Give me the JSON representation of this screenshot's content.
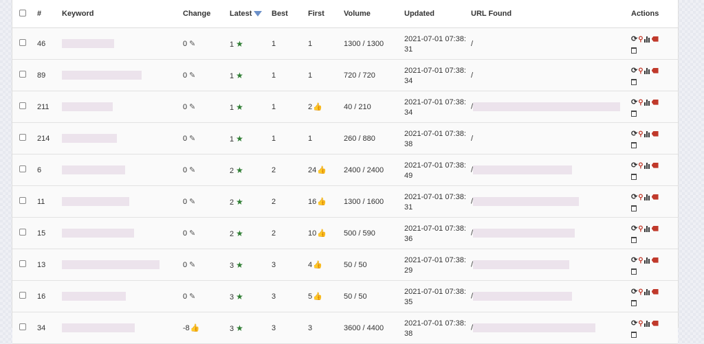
{
  "headers": {
    "num": "#",
    "keyword": "Keyword",
    "change": "Change",
    "latest": "Latest",
    "best": "Best",
    "first": "First",
    "volume": "Volume",
    "updated": "Updated",
    "url": "URL Found",
    "actions": "Actions"
  },
  "rows": [
    {
      "id": "46",
      "change": "0",
      "latest": "1",
      "best": "1",
      "first": "1",
      "first_up": false,
      "volume": "1300 / 1300",
      "updated_date": "2021-07-01 07:38:",
      "updated_sec": "31",
      "url": "/"
    },
    {
      "id": "89",
      "change": "0",
      "latest": "1",
      "best": "1",
      "first": "1",
      "first_up": false,
      "volume": "720 / 720",
      "updated_date": "2021-07-01 07:38:",
      "updated_sec": "34",
      "url": "/"
    },
    {
      "id": "211",
      "change": "0",
      "latest": "1",
      "best": "1",
      "first": "2",
      "first_up": true,
      "volume": "40 / 210",
      "updated_date": "2021-07-01 07:38:",
      "updated_sec": "34",
      "url": "/"
    },
    {
      "id": "214",
      "change": "0",
      "latest": "1",
      "best": "1",
      "first": "1",
      "first_up": false,
      "volume": "260 / 880",
      "updated_date": "2021-07-01 07:38:",
      "updated_sec": "38",
      "url": "/"
    },
    {
      "id": "6",
      "change": "0",
      "latest": "2",
      "best": "2",
      "first": "24",
      "first_up": true,
      "volume": "2400 / 2400",
      "updated_date": "2021-07-01 07:38:",
      "updated_sec": "49",
      "url": "/"
    },
    {
      "id": "11",
      "change": "0",
      "latest": "2",
      "best": "2",
      "first": "16",
      "first_up": true,
      "volume": "1300 / 1600",
      "updated_date": "2021-07-01 07:38:",
      "updated_sec": "31",
      "url": "/"
    },
    {
      "id": "15",
      "change": "0",
      "latest": "2",
      "best": "2",
      "first": "10",
      "first_up": true,
      "volume": "500 / 590",
      "updated_date": "2021-07-01 07:38:",
      "updated_sec": "36",
      "url": "/"
    },
    {
      "id": "13",
      "change": "0",
      "latest": "3",
      "best": "3",
      "first": "4",
      "first_up": true,
      "volume": "50 / 50",
      "updated_date": "2021-07-01 07:38:",
      "updated_sec": "29",
      "url": "/"
    },
    {
      "id": "16",
      "change": "0",
      "latest": "3",
      "best": "3",
      "first": "5",
      "first_up": true,
      "volume": "50 / 50",
      "updated_date": "2021-07-01 07:38:",
      "updated_sec": "35",
      "url": "/"
    },
    {
      "id": "34",
      "change": "-8",
      "latest": "3",
      "best": "3",
      "first": "3",
      "first_up": false,
      "volume": "3600 / 4400",
      "updated_date": "2021-07-01 07:38:",
      "updated_sec": "38",
      "url": "/"
    }
  ],
  "icons": {
    "pin": "pin-icon",
    "star": "star-icon",
    "thumb": "thumbs-up-icon",
    "sort": "sort-desc-icon",
    "refresh": "refresh-icon",
    "search": "search-icon",
    "chart": "bar-chart-icon",
    "tag": "tag-icon",
    "trash": "trash-icon"
  },
  "glyphs": {
    "pin": "✎",
    "star": "★",
    "thumb": "👍",
    "refresh": "⟳",
    "search": "🔍"
  },
  "colors": {
    "star": "#2e7d32",
    "thumb": "#5b9a3a",
    "action_red": "#c0392b",
    "sort_arrow": "#6a8fc8"
  }
}
